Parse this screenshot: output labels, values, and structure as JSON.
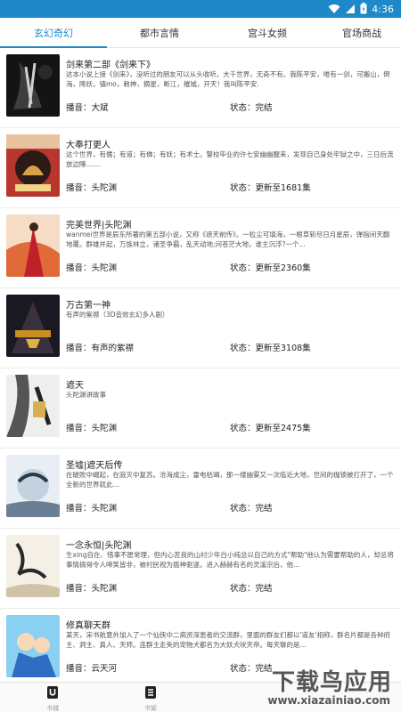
{
  "status_bar": {
    "time": "4:36",
    "icons": [
      "wifi-icon",
      "signal-icon",
      "battery-icon"
    ]
  },
  "tabs": [
    {
      "label": "玄幻奇幻",
      "active": true
    },
    {
      "label": "都市言情",
      "active": false
    },
    {
      "label": "宫斗女频",
      "active": false
    },
    {
      "label": "官场商战",
      "active": false
    }
  ],
  "books": [
    {
      "title": "剑来第二部《剑来下》",
      "desc": "这本小说上接《剑来》，没听过的朋友可以从头收听。大千世界，无奇不有。我陈平安，唯有一剑，可搬山，倒海，降妖，镇mo，敕神，摘星，断江，摧城，开天！我叫陈平安.",
      "narrator": "播音：大斌",
      "status": "状态：完结"
    },
    {
      "title": "大奉打更人",
      "desc": "这个世界，有儒；有道；有佛；有妖；有术士。警校毕业的许七安幽幽醒来，发现自己身处牢狱之中，三日后流放边陲.......",
      "narrator": "播音：头陀渊",
      "status": "状态：更新至1681集"
    },
    {
      "title": "完美世界|头陀渊",
      "desc": "wanmei世界是辰东所著的第五部小说，又称《遮天前传》。一粒尘可填海，一根草斩尽日月星辰，弹指间天翻地覆。群雄并起，万族林立，诸圣争霸，乱天动地;问苍茫大地，谁主沉浮?一个...",
      "narrator": "播音：头陀渊",
      "status": "状态：更新至2360集"
    },
    {
      "title": "万古第一神",
      "desc": "有声的紫襟（3D音效玄幻多人剧）",
      "narrator": "播音：有声的紫襟",
      "status": "状态：更新至3108集"
    },
    {
      "title": "遮天",
      "desc": "头陀渊讲故事",
      "narrator": "播音：头陀渊",
      "status": "状态：更新至2475集"
    },
    {
      "title": "圣墟|遮天后传",
      "desc": "在破败中崛起，在寂灭中复苏。沧海成尘，雷电枯竭，那一缕幽雾又一次临近大地，世间的枷锁被打开了，一个全新的世界就此...",
      "narrator": "播音：头陀渊",
      "status": "状态：完结"
    },
    {
      "title": "一念永恒|头陀渊",
      "desc": "生xing自在、惜事不愿常理，但内心苦良的山村少年白小纯总以自己的方式\"帮助\"他认为需要帮助的人，却总将事情搞得令人啼笑皆非，被村民视为瘟神驱逐。进入赫赫有名的灵溪宗后，他...",
      "narrator": "播音：头陀渊",
      "status": "状态：完结"
    },
    {
      "title": "修真聊天群",
      "desc": "某天，宋书航意外加入了一个仙侠中二病资深患者的交流群，里面的群友们都以'道友'相称，群名片都是各种府主、洞主、真人、天师。连群主走失的宠物犬都名为大妖犬吠天帝。每天聊的是...",
      "narrator": "播音：云天河",
      "status": "状态：完结"
    }
  ],
  "bottom_nav": [
    {
      "label": "书城",
      "icon": "bookstore-icon"
    },
    {
      "label": "书架",
      "icon": "bookshelf-icon"
    }
  ],
  "watermark": {
    "main": "下载鸟应用",
    "url": "www.xiazainiao.com"
  },
  "colors": {
    "accent": "#1e88c9"
  }
}
